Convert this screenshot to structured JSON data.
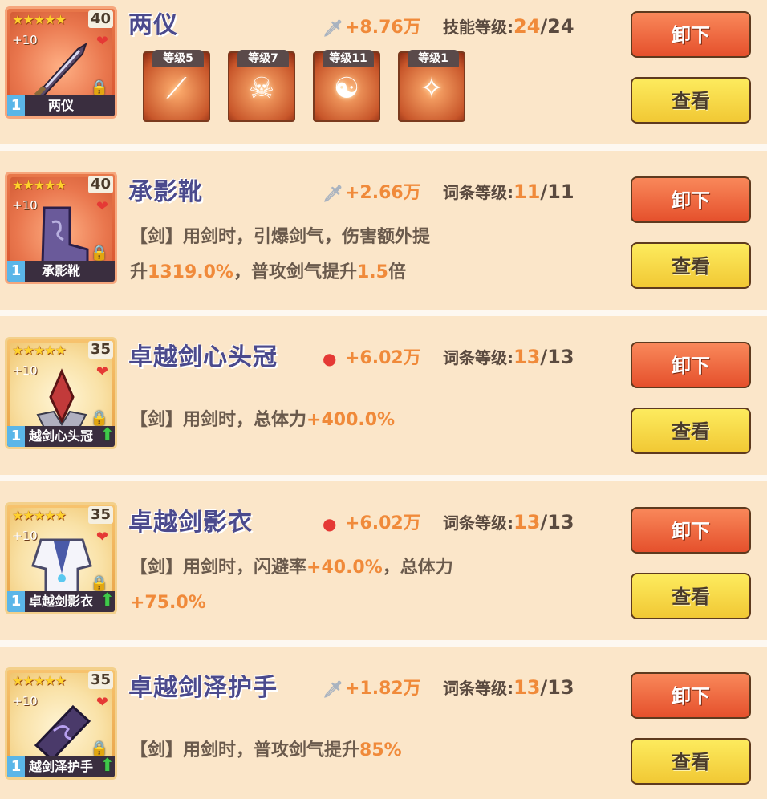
{
  "items": [
    {
      "name": "两仪",
      "card_name": "两仪",
      "card_level": "40",
      "card_plus": "+10",
      "tier": "1",
      "stars": "★★★★★",
      "card_color": "orange",
      "stat_icon": "sword-icon",
      "stat_value": "+8.76万",
      "level_label": "技能等级:",
      "level_current": "24",
      "level_max": "24",
      "skills": [
        {
          "label": "等级5",
          "icon": "slash-icon"
        },
        {
          "label": "等级7",
          "icon": "ninja-icon"
        },
        {
          "label": "等级11",
          "icon": "yin-yang-icon"
        },
        {
          "label": "等级1",
          "icon": "sword-circle-icon"
        }
      ],
      "unequip_label": "卸下",
      "view_label": "查看"
    },
    {
      "name": "承影靴",
      "card_name": "承影靴",
      "card_level": "40",
      "card_plus": "+10",
      "tier": "1",
      "stars": "★★★★★",
      "card_color": "orange",
      "stat_icon": "sword-icon",
      "stat_value": "+2.66万",
      "level_label": "词条等级:",
      "level_current": "11",
      "level_max": "11",
      "desc_1": "【剑】用剑时，引爆剑气，伤害额外提",
      "desc_2a": "升",
      "desc_2b": "1319.0%",
      "desc_2c": "，普攻剑气提升",
      "desc_2d": "1.5",
      "desc_2e": "倍",
      "unequip_label": "卸下",
      "view_label": "查看"
    },
    {
      "name": "卓越剑心头冠",
      "card_name": "越剑心头冠",
      "card_level": "35",
      "card_plus": "+10",
      "tier": "1",
      "stars": "★★★★★",
      "card_color": "gold",
      "stat_icon": "heart-icon",
      "stat_value": "+6.02万",
      "level_label": "词条等级:",
      "level_current": "13",
      "level_max": "13",
      "desc_a": "【剑】用剑时，总体力",
      "desc_b": "+400.0%",
      "unequip_label": "卸下",
      "view_label": "查看"
    },
    {
      "name": "卓越剑影衣",
      "card_name": "卓越剑影衣",
      "card_level": "35",
      "card_plus": "+10",
      "tier": "1",
      "stars": "★★★★★",
      "card_color": "gold",
      "stat_icon": "heart-icon",
      "stat_value": "+6.02万",
      "level_label": "词条等级:",
      "level_current": "13",
      "level_max": "13",
      "desc_1a": "【剑】用剑时，闪避率",
      "desc_1b": "+40.0%",
      "desc_1c": "，总体力",
      "desc_2": "+75.0%",
      "unequip_label": "卸下",
      "view_label": "查看"
    },
    {
      "name": "卓越剑泽护手",
      "card_name": "越剑泽护手",
      "card_level": "35",
      "card_plus": "+10",
      "tier": "1",
      "stars": "★★★★★",
      "card_color": "gold",
      "stat_icon": "sword-icon",
      "stat_value": "+1.82万",
      "level_label": "词条等级:",
      "level_current": "13",
      "level_max": "13",
      "desc_a": "【剑】用剑时，普攻剑气提升",
      "desc_b": "85%",
      "unequip_label": "卸下",
      "view_label": "查看"
    }
  ]
}
